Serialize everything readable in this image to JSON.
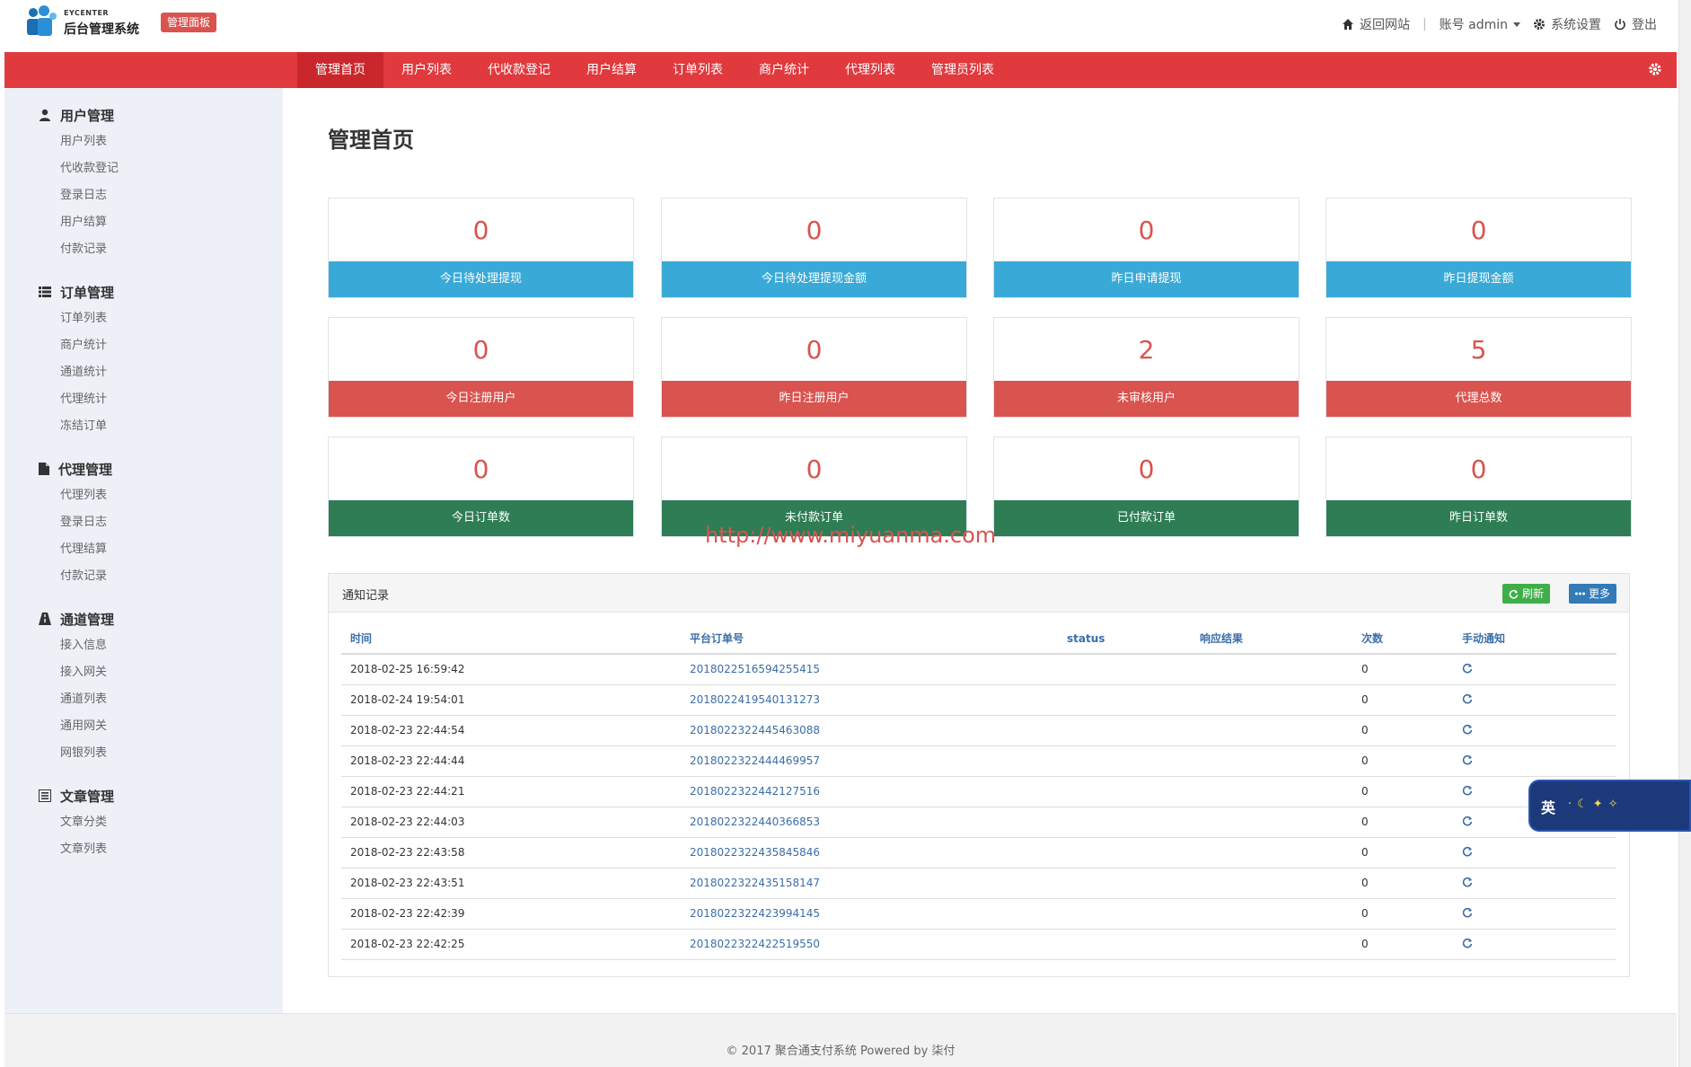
{
  "header": {
    "logo_small": "EYCENTER",
    "logo_main": "后台管理系统",
    "badge": "管理面板",
    "links": {
      "back_site": "返回网站",
      "account": "账号 admin",
      "settings": "系统设置",
      "logout": "登出"
    }
  },
  "nav": {
    "items": [
      {
        "label": "管理首页"
      },
      {
        "label": "用户列表"
      },
      {
        "label": "代收款登记"
      },
      {
        "label": "用户结算"
      },
      {
        "label": "订单列表"
      },
      {
        "label": "商户统计"
      },
      {
        "label": "代理列表"
      },
      {
        "label": "管理员列表"
      }
    ]
  },
  "sidebar": {
    "groups": [
      {
        "title": "用户管理",
        "items": [
          "用户列表",
          "代收款登记",
          "登录日志",
          "用户结算",
          "付款记录"
        ]
      },
      {
        "title": "订单管理",
        "items": [
          "订单列表",
          "商户统计",
          "通道统计",
          "代理统计",
          "冻结订单"
        ]
      },
      {
        "title": "代理管理",
        "items": [
          "代理列表",
          "登录日志",
          "代理结算",
          "付款记录"
        ]
      },
      {
        "title": "通道管理",
        "items": [
          "接入信息",
          "接入网关",
          "通道列表",
          "通用网关",
          "网银列表"
        ]
      },
      {
        "title": "文章管理",
        "items": [
          "文章分类",
          "文章列表"
        ]
      }
    ]
  },
  "main": {
    "title": "管理首页",
    "cards": [
      {
        "value": "0",
        "label": "今日待处理提现"
      },
      {
        "value": "0",
        "label": "今日待处理提现金额"
      },
      {
        "value": "0",
        "label": "昨日申请提现"
      },
      {
        "value": "0",
        "label": "昨日提现金额"
      },
      {
        "value": "0",
        "label": "今日注册用户"
      },
      {
        "value": "0",
        "label": "昨日注册用户"
      },
      {
        "value": "2",
        "label": "未审核用户"
      },
      {
        "value": "5",
        "label": "代理总数"
      },
      {
        "value": "0",
        "label": "今日订单数"
      },
      {
        "value": "0",
        "label": "未付款订单"
      },
      {
        "value": "0",
        "label": "已付款订单"
      },
      {
        "value": "0",
        "label": "昨日订单数"
      }
    ],
    "watermark": "http://www.miyuanma.com",
    "notice": {
      "title": "通知记录",
      "refresh": "刷新",
      "more": "更多",
      "columns": [
        "时间",
        "平台订单号",
        "status",
        "响应结果",
        "次数",
        "手动通知"
      ],
      "rows": [
        {
          "time": "2018-02-25 16:59:42",
          "order": "2018022516594255415",
          "status": "",
          "result": "",
          "count": "0"
        },
        {
          "time": "2018-02-24 19:54:01",
          "order": "2018022419540131273",
          "status": "",
          "result": "",
          "count": "0"
        },
        {
          "time": "2018-02-23 22:44:54",
          "order": "2018022322445463088",
          "status": "",
          "result": "",
          "count": "0"
        },
        {
          "time": "2018-02-23 22:44:44",
          "order": "2018022322444469957",
          "status": "",
          "result": "",
          "count": "0"
        },
        {
          "time": "2018-02-23 22:44:21",
          "order": "2018022322442127516",
          "status": "",
          "result": "",
          "count": "0"
        },
        {
          "time": "2018-02-23 22:44:03",
          "order": "2018022322440366853",
          "status": "",
          "result": "",
          "count": "0"
        },
        {
          "time": "2018-02-23 22:43:58",
          "order": "2018022322435845846",
          "status": "",
          "result": "",
          "count": "0"
        },
        {
          "time": "2018-02-23 22:43:51",
          "order": "2018022322435158147",
          "status": "",
          "result": "",
          "count": "0"
        },
        {
          "time": "2018-02-23 22:42:39",
          "order": "2018022322423994145",
          "status": "",
          "result": "",
          "count": "0"
        },
        {
          "time": "2018-02-23 22:42:25",
          "order": "2018022322422519550",
          "status": "",
          "result": "",
          "count": "0"
        }
      ]
    }
  },
  "footer": {
    "text": "© 2017 聚合通支付系统 Powered by 柒付"
  },
  "ime": {
    "label": "英"
  },
  "colors": {
    "nav_red": "#e0393e",
    "blue": "#39aad7",
    "red": "#d9534f",
    "green": "#2e7d55"
  }
}
